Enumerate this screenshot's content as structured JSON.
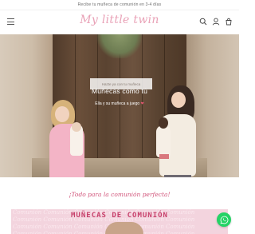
{
  "announcement": {
    "text": "Recibe tu muñeca de comunión en 3-4 días"
  },
  "header": {
    "logo_text": "My little twin",
    "icons": [
      "menu-icon",
      "search-icon",
      "account-icon",
      "cart-icon"
    ]
  },
  "hero": {
    "title": "Muñecas como tú",
    "subtitle": "Ella y su muñeca a juego",
    "subtitle_heart": "❤",
    "button_label": "Hazte ya con tu muñeca"
  },
  "section": {
    "title": "¡Todo para la comunión perfecta!"
  },
  "banner": {
    "title": "MUÑECAS DE COMUNIÓN",
    "pattern_text": "Comunión Comunión Comunión Comunión Comunión Comunión"
  },
  "floating": {
    "icon": "whatsapp-icon"
  },
  "colors": {
    "brand_pink": "#e9a2b7",
    "accent_pink": "#d1547a",
    "banner_bg": "#f3d4de",
    "whatsapp_green": "#25d366"
  }
}
